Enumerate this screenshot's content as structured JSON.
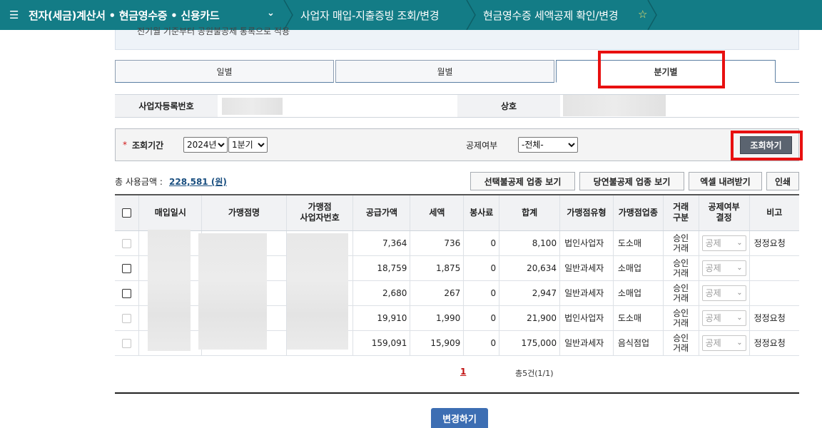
{
  "nav": {
    "menu_label": "전자(세금)계산서 • 현금영수증 • 신용카드",
    "crumb_2": "사업자 매입-지출증빙 조회/변경",
    "crumb_3": "현금영수증 세액공제 확인/변경",
    "accent_color": "#137c86"
  },
  "banner": {
    "text": "전기월 기준부터 공원불공제 통록으로 적용"
  },
  "tabs": [
    {
      "label": "일별",
      "active": false
    },
    {
      "label": "월별",
      "active": false
    },
    {
      "label": "분기별",
      "active": true
    }
  ],
  "business": {
    "reg_no_label": "사업자등록번호",
    "name_label": "상호"
  },
  "search": {
    "period_label": "조회기간",
    "year_selected": "2024년",
    "quarter_selected": "1분기",
    "deduct_label": "공제여부",
    "deduct_selected": "-전체-",
    "button_label": "조회하기"
  },
  "summary": {
    "total_label": "총 사용금액 :",
    "total_value": "228,581 (원)"
  },
  "actions": {
    "choice_industry": "선택불공제 업종 보기",
    "default_industry": "당연불공제 업종 보기",
    "excel": "엑셀 내려받기",
    "print": "인쇄"
  },
  "table": {
    "headers": {
      "date": "매입일시",
      "merchant": "가맹점명",
      "merchant_biz_no_l1": "가맹점",
      "merchant_biz_no_l2": "사업자번호",
      "supply": "공급가액",
      "tax": "세액",
      "service": "봉사료",
      "total": "합계",
      "merchant_type": "가맹점유형",
      "industry": "가맹점업종",
      "tx_l1": "거래",
      "tx_l2": "구분",
      "deduct_l1": "공제여부",
      "deduct_l2": "결정",
      "note": "비고"
    },
    "rows": [
      {
        "checkbox_enabled": false,
        "supply": "7,364",
        "tax": "736",
        "service": "0",
        "total": "8,100",
        "type": "법인사업자",
        "industry": "도소매",
        "tx_l1": "승인",
        "tx_l2": "거래",
        "deduct": "공제",
        "note": "정정요청"
      },
      {
        "checkbox_enabled": true,
        "supply": "18,759",
        "tax": "1,875",
        "service": "0",
        "total": "20,634",
        "type": "일반과세자",
        "industry": "소매업",
        "tx_l1": "승인",
        "tx_l2": "거래",
        "deduct": "공제",
        "note": ""
      },
      {
        "checkbox_enabled": true,
        "supply": "2,680",
        "tax": "267",
        "service": "0",
        "total": "2,947",
        "type": "일반과세자",
        "industry": "소매업",
        "tx_l1": "승인",
        "tx_l2": "거래",
        "deduct": "공제",
        "note": ""
      },
      {
        "checkbox_enabled": false,
        "supply": "19,910",
        "tax": "1,990",
        "service": "0",
        "total": "21,900",
        "type": "법인사업자",
        "industry": "도소매",
        "tx_l1": "승인",
        "tx_l2": "거래",
        "deduct": "공제",
        "note": "정정요청"
      },
      {
        "checkbox_enabled": false,
        "supply": "159,091",
        "tax": "15,909",
        "service": "0",
        "total": "175,000",
        "type": "일반과세자",
        "industry": "음식점업",
        "tx_l1": "승인",
        "tx_l2": "거래",
        "deduct": "공제",
        "note": "정정요청"
      }
    ]
  },
  "pagination": {
    "current": "1",
    "info": "총5건(1/1)"
  },
  "footer": {
    "change_button": "변경하기"
  }
}
